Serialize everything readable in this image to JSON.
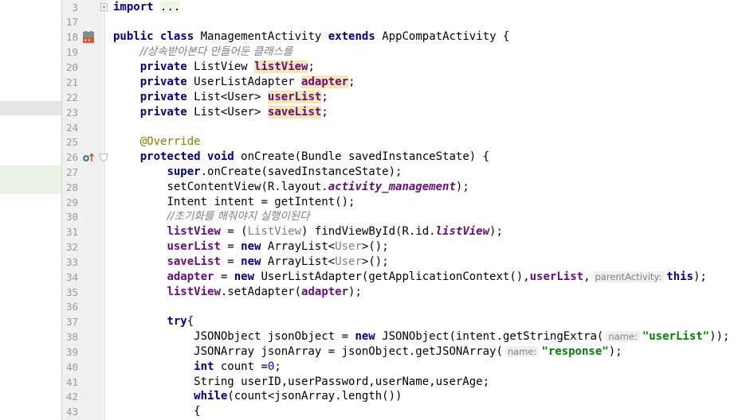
{
  "gutter": {
    "line_numbers": [
      "3",
      "17",
      "18",
      "19",
      "20",
      "21",
      "22",
      "23",
      "24",
      "25",
      "26",
      "27",
      "28",
      "29",
      "30",
      "31",
      "32",
      "33",
      "34",
      "35",
      "36",
      "37",
      "38",
      "39",
      "40",
      "41",
      "42",
      "43"
    ],
    "icons": {
      "line18": "android-activity-icon",
      "line26": "override-method-icon"
    }
  },
  "code": {
    "l3": {
      "import": "import",
      "dots": "..."
    },
    "l18": {
      "public": "public",
      "class": "class",
      "name": "ManagementActivity",
      "extends": "extends",
      "parent": "AppCompatActivity {"
    },
    "l19": {
      "comment": "//상속받아본다 만들어둔 클래스를"
    },
    "l20": {
      "private": "private",
      "type": "ListView",
      "field": "listView",
      "end": ";"
    },
    "l21": {
      "private": "private",
      "type": "UserListAdapter",
      "field": "adapter",
      "end": ";"
    },
    "l22": {
      "private": "private",
      "type": "List<User>",
      "field": "userList",
      "end": ";"
    },
    "l23": {
      "private": "private",
      "type": "List<User>",
      "field": "saveList",
      "end": ";"
    },
    "l25": {
      "annotation": "@Override"
    },
    "l26": {
      "protected": "protected",
      "void": "void",
      "rest": "onCreate(Bundle savedInstanceState) {"
    },
    "l27": {
      "super": "super",
      "rest": ".onCreate(savedInstanceState);"
    },
    "l28": {
      "a": "setContentView(R.layout.",
      "sfield": "activity_management",
      "b": ");"
    },
    "l29": {
      "text": "Intent intent = getIntent();"
    },
    "l30": {
      "comment": "//초기화를 해줘야지 실행이된다"
    },
    "l31": {
      "field": "listView",
      "a": " = (",
      "cast": "ListView",
      "b": ") findViewById(R.id.",
      "sfield": "listView",
      "c": ");"
    },
    "l32": {
      "field": "userList",
      "a": " = ",
      "new": "new",
      "b": " ArrayList<",
      "gen": "User",
      "c": ">();"
    },
    "l33": {
      "field": "saveList",
      "a": " = ",
      "new": "new",
      "b": " ArrayList<",
      "gen": "User",
      "c": ">();"
    },
    "l34": {
      "field": "adapter",
      "a": " = ",
      "new": "new",
      "b": " UserListAdapter(getApplicationContext(),",
      "field2": "userList",
      "c": ",",
      "hint": "parentActivity:",
      "this": "this",
      "d": ");"
    },
    "l35": {
      "field": "listView",
      "a": ".setAdapter(",
      "field2": "adapter",
      "b": ");"
    },
    "l37": {
      "try": "try",
      "brace": "{"
    },
    "l38": {
      "a": "JSONObject jsonObject = ",
      "new": "new",
      "b": " JSONObject(intent.getStringExtra(",
      "hint": "name:",
      "str": "\"userList\"",
      "c": "));"
    },
    "l39": {
      "a": "JSONArray jsonArray = jsonObject.getJSONArray(",
      "hint": "name:",
      "str": "\"response\"",
      "c": ");"
    },
    "l40": {
      "int": "int",
      "a": " count =",
      "num": "0",
      "b": ";"
    },
    "l41": {
      "text": "String userID,userPassword,userName,userAge;"
    },
    "l42": {
      "while": "while",
      "rest": "(count<jsonArray.length())"
    },
    "l43": {
      "brace": "{"
    }
  },
  "colors": {
    "keyword": "#000080",
    "field": "#660e7a",
    "string": "#008000",
    "comment": "#808080",
    "annotation": "#808000",
    "number": "#0000ff",
    "field_highlight": "#f5e6b8"
  }
}
